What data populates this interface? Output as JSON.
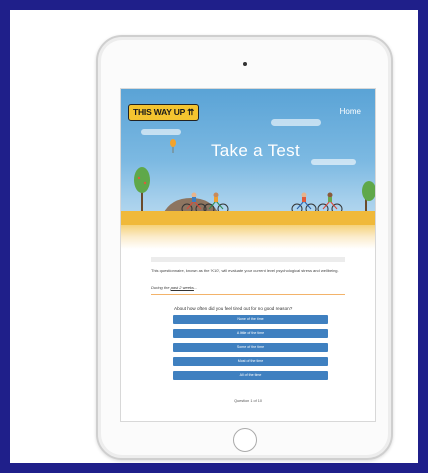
{
  "header": {
    "logo_text": "THIS WAY UP ⇈",
    "home_label": "Home",
    "hero_title": "Take a Test"
  },
  "questionnaire": {
    "intro": "This questionnaire, known as the 'K10', will evaluate your current level psychological stress and wellbeing.",
    "during_prefix": "During the ",
    "during_link": "past 2 weeks",
    "during_suffix": "...",
    "question": "About how often did you feel tired out for no good reason?",
    "options": [
      "None of the time",
      "A little of the time",
      "Some of the time",
      "Most of the time",
      "All of the time"
    ],
    "counter": "Question 1 of 10"
  },
  "colors": {
    "frame_border": "#1f1f8a",
    "logo_bg": "#f4c430",
    "option_bg": "#3f80c0",
    "sky": "#7cb9e2",
    "ground": "#f0b93a"
  },
  "icons": [
    "camera-icon",
    "home-button-icon",
    "balloon-icon",
    "tree-icon",
    "cyclist-icon"
  ]
}
